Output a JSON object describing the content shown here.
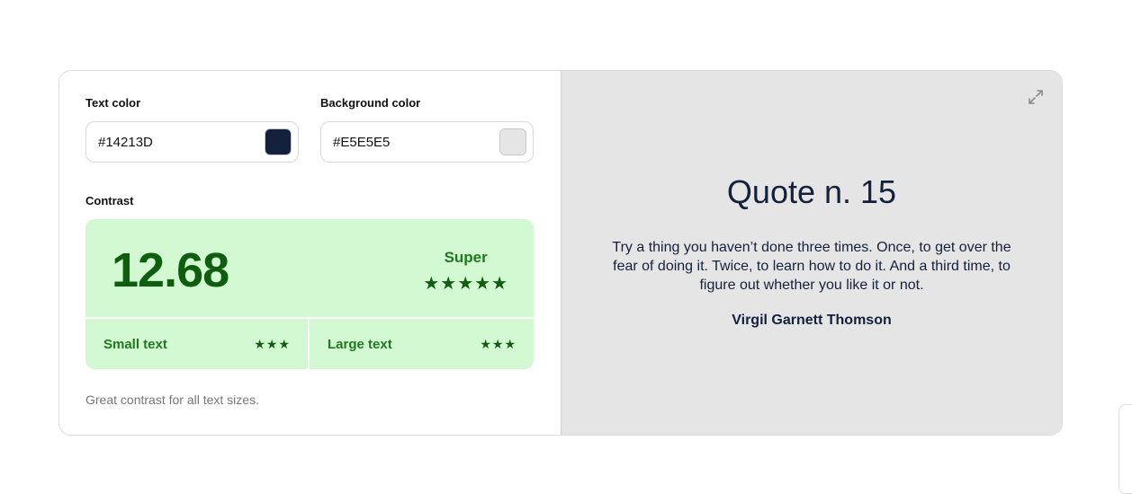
{
  "text_color": {
    "label": "Text color",
    "value": "#14213D",
    "swatch": "#14213D"
  },
  "background_color": {
    "label": "Background color",
    "value": "#E5E5E5",
    "swatch": "#E5E5E5"
  },
  "contrast": {
    "label": "Contrast",
    "ratio": "12.68",
    "rating": "Super",
    "rating_stars": "★★★★★",
    "small_text": {
      "label": "Small text",
      "stars": "★★★"
    },
    "large_text": {
      "label": "Large text",
      "stars": "★★★"
    },
    "hint": "Great contrast for all text sizes.",
    "color": "#0F5E0F",
    "background": "#D2F9D2"
  },
  "preview": {
    "title": "Quote n. 15",
    "quote": "Try a thing you haven’t done three times. Once, to get over the fear of doing it. Twice, to learn how to do it. And a third time, to figure out whether you like it or not.",
    "author": "Virgil Garnett Thomson",
    "expand_icon": "expand-icon"
  }
}
